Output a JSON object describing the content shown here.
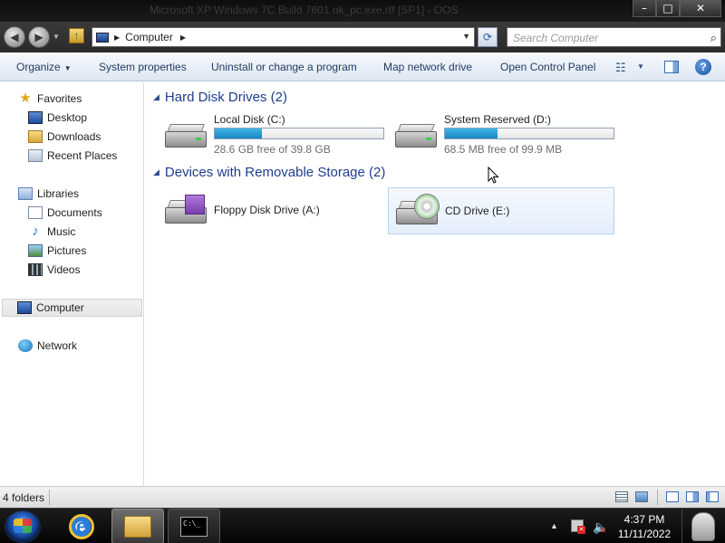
{
  "window": {
    "title": "Microsoft XP Windows 7C Build 7601 ok_pc.exe.rtf [SP1] - OOS",
    "controls": {
      "minimize": "–",
      "maximize": "□",
      "close": "✕"
    }
  },
  "navbar": {
    "address_location": "Computer",
    "search_placeholder": "Search Computer"
  },
  "command_bar": {
    "organize": "Organize",
    "system_properties": "System properties",
    "uninstall": "Uninstall or change a program",
    "map_network_drive": "Map network drive",
    "open_control_panel": "Open Control Panel"
  },
  "nav_pane": {
    "favorites": "Favorites",
    "desktop": "Desktop",
    "downloads": "Downloads",
    "recent_places": "Recent Places",
    "libraries": "Libraries",
    "documents": "Documents",
    "music": "Music",
    "pictures": "Pictures",
    "videos": "Videos",
    "computer": "Computer",
    "network": "Network"
  },
  "content": {
    "hard_disk_header": "Hard Disk Drives (2)",
    "removable_header": "Devices with Removable Storage (2)",
    "drives": [
      {
        "name": "Local Disk (C:)",
        "free": "28.6 GB free of 39.8 GB",
        "used_fraction": 0.28
      },
      {
        "name": "System Reserved (D:)",
        "free": "68.5 MB free of 99.9 MB",
        "used_fraction": 0.31
      }
    ],
    "removable": [
      {
        "name": "Floppy Disk Drive (A:)"
      },
      {
        "name": "CD Drive (E:)"
      }
    ]
  },
  "status": {
    "item_count": "4 folders"
  },
  "taskbar": {
    "time": "4:37 PM",
    "date": "11/11/2022"
  },
  "colors": {
    "group_header": "#1e3e8c",
    "bar_fill": "#1c86c2",
    "selection_border": "#b8d1ef"
  }
}
